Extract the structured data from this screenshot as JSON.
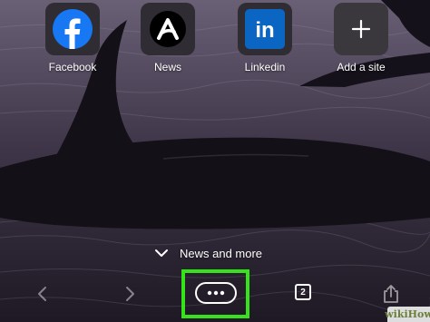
{
  "shortcuts": [
    {
      "label": "Facebook",
      "icon": "facebook-icon",
      "color": "#1877f2"
    },
    {
      "label": "News",
      "icon": "news-icon",
      "color": "#000000"
    },
    {
      "label": "Linkedin",
      "icon": "linkedin-icon",
      "color": "#0a66c2"
    },
    {
      "label": "Add a site",
      "icon": "plus-icon",
      "color": "#3a373d"
    }
  ],
  "news_more": {
    "label": "News and more",
    "icon": "chevron-down-icon"
  },
  "toolbar": {
    "back_icon": "chevron-left-icon",
    "forward_icon": "chevron-right-icon",
    "menu_icon": "more-horizontal-icon",
    "tabs_count": "2",
    "share_icon": "share-icon",
    "highlight_color": "#36e21a"
  },
  "watermark": {
    "text": "wikiHow"
  },
  "background": {
    "description_icon": "orca-wallpaper"
  }
}
